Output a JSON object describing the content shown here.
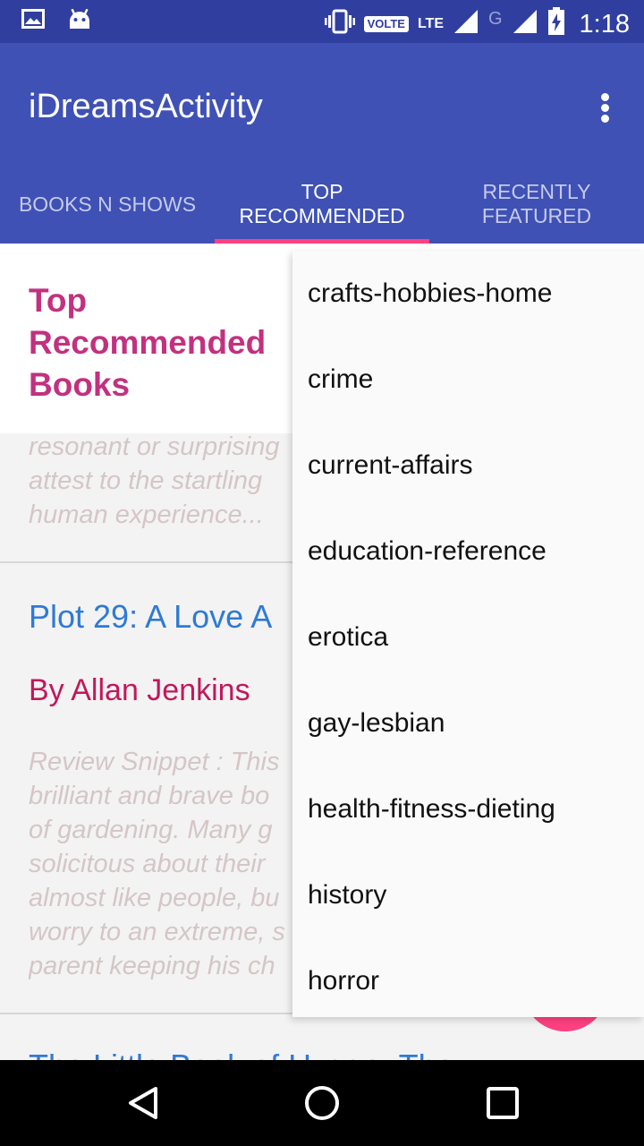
{
  "status_bar": {
    "volte": "VOLTE",
    "network": "LTE",
    "network_secondary": "G",
    "time": "1:18",
    "icons": [
      "gallery-icon",
      "android-icon",
      "vibrate-icon",
      "signal-icon",
      "battery-charging-icon"
    ]
  },
  "app_bar": {
    "title": "iDreamsActivity",
    "tabs": [
      {
        "label": "BOOKS N SHOWS",
        "selected": false
      },
      {
        "label": "TOP\nRECOMMENDED",
        "selected": true
      },
      {
        "label": "RECENTLY\nFEATURED",
        "selected": false
      }
    ]
  },
  "content": {
    "section_title": "Top Recommended Books",
    "snippet_1": [
      "resonant or surprising",
      "attest to the startling",
      "human experience..."
    ],
    "book_1": {
      "title": "Plot 29: A Love A",
      "author": "By Allan Jenkins",
      "snippet": [
        "Review Snippet : This",
        "brilliant and brave bo",
        "of gardening. Many g",
        "solicitous about their",
        "almost like people, bu",
        "worry to an extreme, s",
        "parent keeping his ch"
      ]
    },
    "book_2": {
      "title": "The Little Book of Hygge: The"
    }
  },
  "menu": {
    "items": [
      "crafts-hobbies-home",
      "crime",
      "current-affairs",
      "education-reference",
      "erotica",
      "gay-lesbian",
      "health-fitness-dieting",
      "history",
      "horror"
    ]
  },
  "colors": {
    "status_bar": "#303f9f",
    "app_bar": "#3f51b5",
    "accent": "#ff4081",
    "section_title": "#c2317f",
    "book_title": "#2f7ad6",
    "author": "#c2185b"
  }
}
